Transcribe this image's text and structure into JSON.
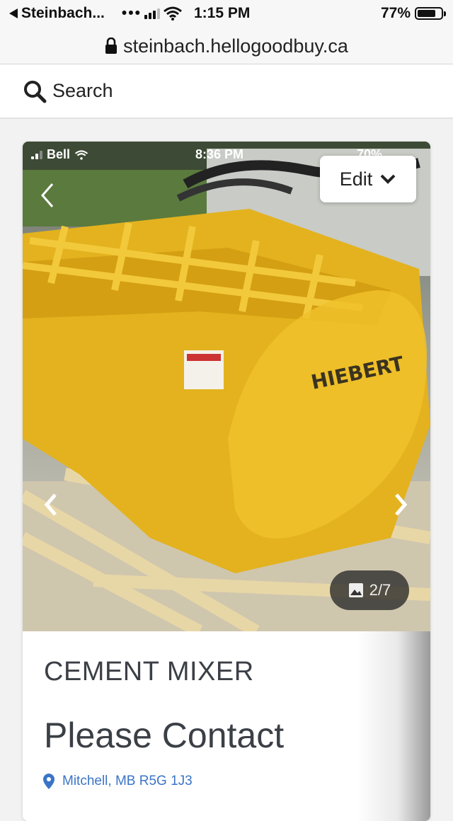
{
  "status_bar": {
    "back_app": "Steinbach...",
    "time": "1:15 PM",
    "battery": "77%",
    "battery_level": 0.77
  },
  "browser": {
    "url": "steinbach.hellogoodbuy.ca"
  },
  "search": {
    "label": "Search"
  },
  "listing": {
    "photo": {
      "inner_status": {
        "carrier": "Bell",
        "time": "8:36 PM",
        "battery": "70%"
      },
      "edit_label": "Edit",
      "counter": "2/7"
    },
    "title": "CEMENT MIXER",
    "price": "Please Contact",
    "location": "Mitchell, MB R5G 1J3"
  },
  "icons": [
    "back-triangle-icon",
    "signal-icon",
    "wifi-icon",
    "battery-icon",
    "lock-icon",
    "search-icon",
    "chevron-down-icon",
    "chevron-left-icon",
    "chevron-right-icon",
    "image-icon",
    "map-pin-icon"
  ],
  "colors": {
    "link_blue": "#3b74c7",
    "text_dark": "#3b3f46",
    "machine_yellow": "#e8b923"
  }
}
